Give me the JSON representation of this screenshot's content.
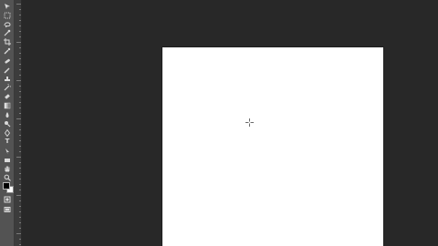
{
  "app": {
    "canvas_bg": "#282828",
    "toolbar_bg": "#535353",
    "document_bg": "#ffffff"
  },
  "toolbar": {
    "tools": [
      {
        "name": "move-icon"
      },
      {
        "name": "marquee-icon"
      },
      {
        "name": "lasso-icon"
      },
      {
        "name": "quick-select-icon"
      },
      {
        "name": "crop-icon"
      },
      {
        "name": "eyedropper-icon"
      },
      {
        "name": "healing-brush-icon"
      },
      {
        "name": "brush-icon"
      },
      {
        "name": "clone-stamp-icon"
      },
      {
        "name": "history-brush-icon"
      },
      {
        "name": "eraser-icon"
      },
      {
        "name": "gradient-icon"
      },
      {
        "name": "blur-icon"
      },
      {
        "name": "dodge-icon"
      },
      {
        "name": "pen-icon"
      },
      {
        "name": "type-icon",
        "glyph": "T"
      },
      {
        "name": "path-select-icon"
      },
      {
        "name": "rectangle-shape-icon"
      },
      {
        "name": "hand-icon"
      },
      {
        "name": "zoom-icon"
      },
      {
        "name": "more-tools-icon",
        "glyph": "…"
      }
    ],
    "foreground_color": "#000000",
    "background_color": "#ffffff"
  },
  "ruler": {
    "orientation": "vertical"
  }
}
